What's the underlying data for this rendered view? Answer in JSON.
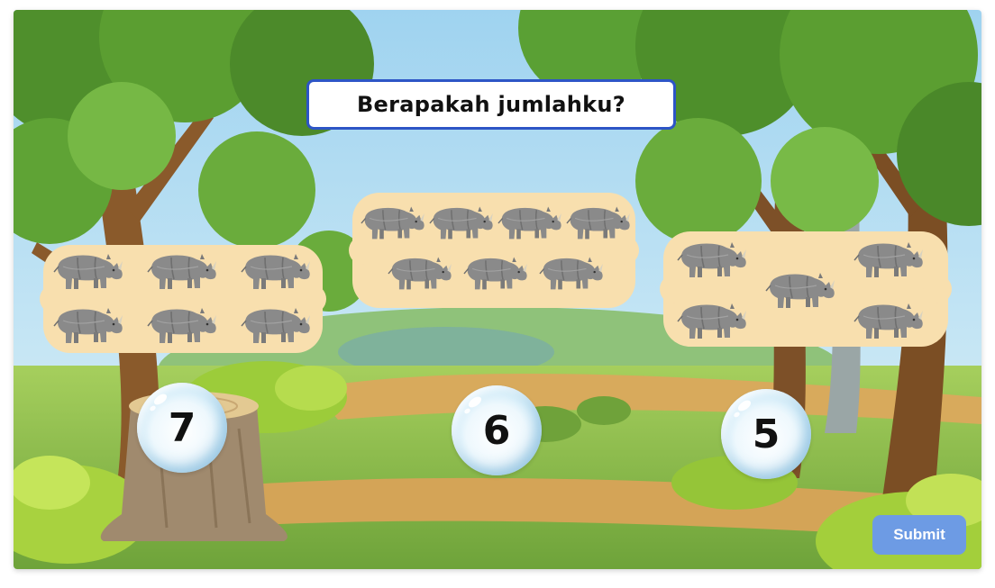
{
  "game": {
    "question": "Berapakah jumlahku?",
    "groups": [
      {
        "count": 6,
        "animal_icon": "rhino-icon"
      },
      {
        "count": 7,
        "animal_icon": "rhino-icon"
      },
      {
        "count": 5,
        "animal_icon": "rhino-icon"
      }
    ],
    "choices": [
      {
        "label": "7"
      },
      {
        "label": "6"
      },
      {
        "label": "5"
      }
    ],
    "submit_label": "Submit"
  },
  "colors": {
    "title_border": "#2d55c6",
    "card_fill": "#f8dfae",
    "rhino_body": "#8a8a8a",
    "bubble_edge": "#8ccbea",
    "submit_button": "#6d9be4",
    "grass": "#86b94a",
    "path": "#d7a95a",
    "sky": "#bfe3f6"
  }
}
